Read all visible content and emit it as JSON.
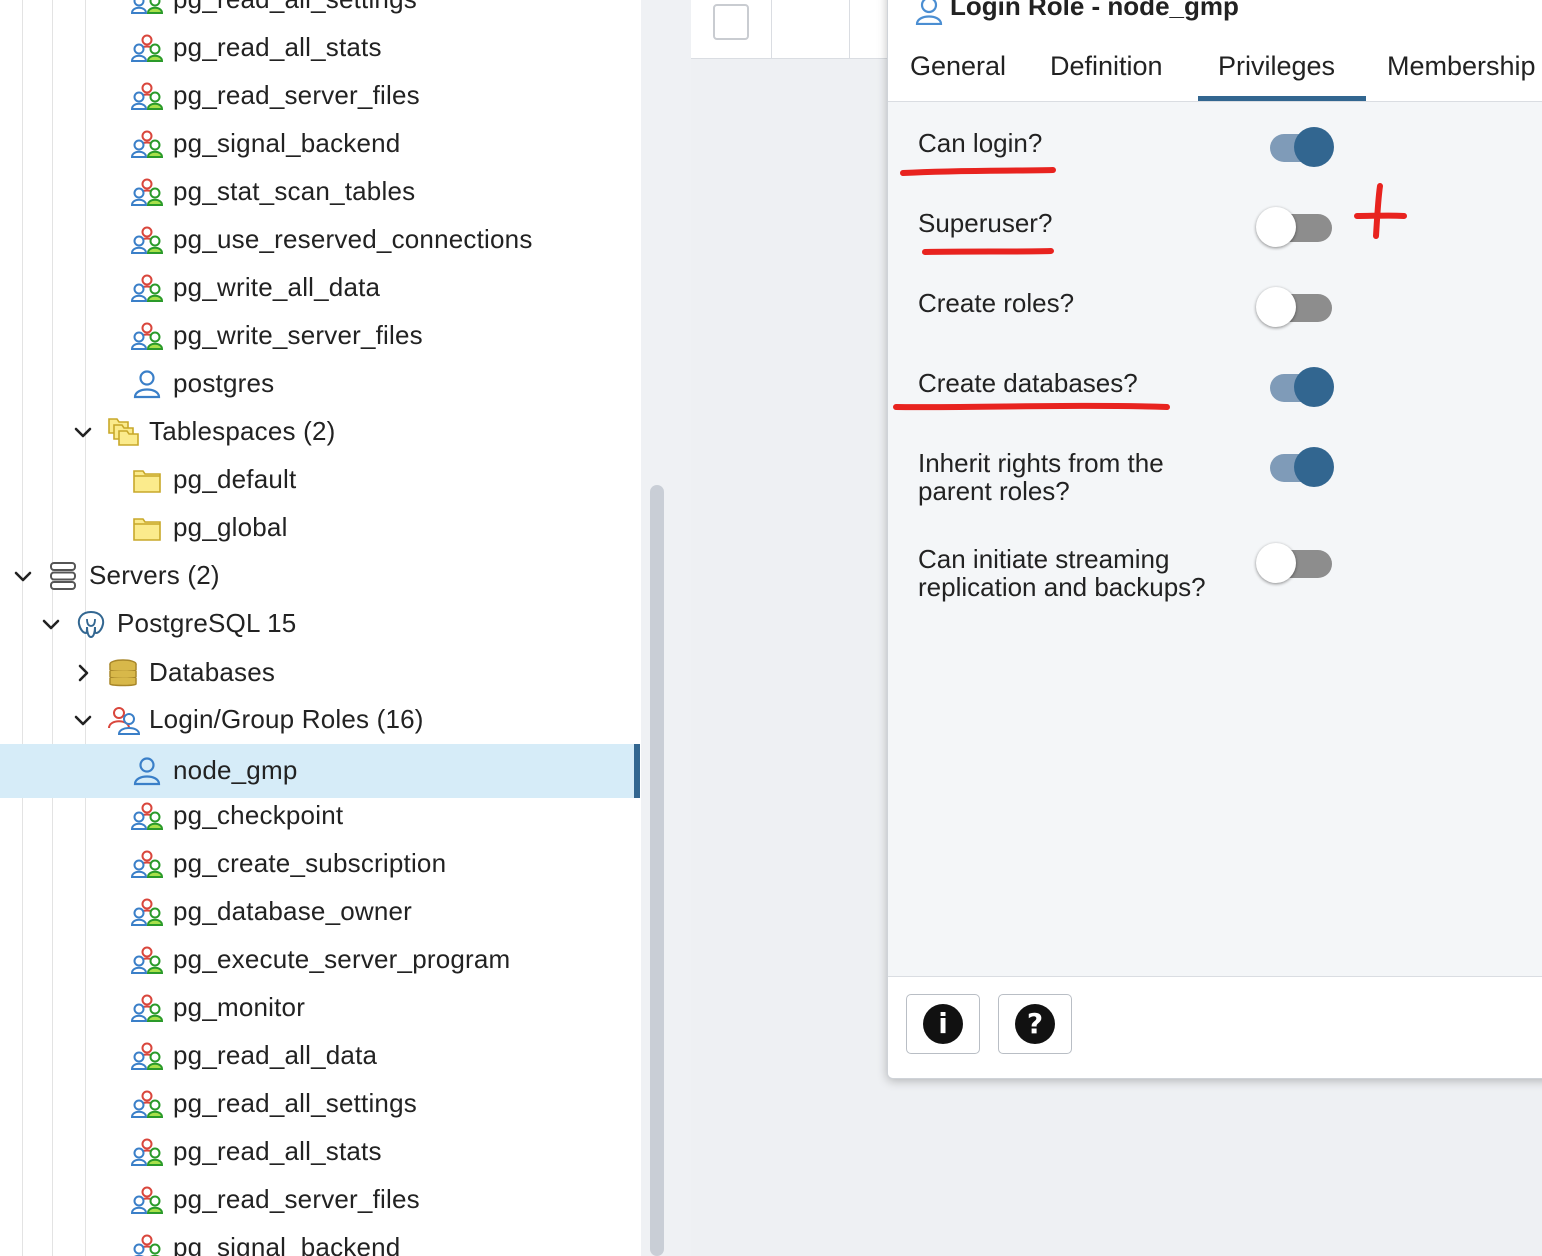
{
  "tree": {
    "items": [
      {
        "label": "pg_read_all_settings",
        "icon": "group-role-icon",
        "level": 3
      },
      {
        "label": "pg_read_all_stats",
        "icon": "group-role-icon",
        "level": 3
      },
      {
        "label": "pg_read_server_files",
        "icon": "group-role-icon",
        "level": 3
      },
      {
        "label": "pg_signal_backend",
        "icon": "group-role-icon",
        "level": 3
      },
      {
        "label": "pg_stat_scan_tables",
        "icon": "group-role-icon",
        "level": 3
      },
      {
        "label": "pg_use_reserved_connections",
        "icon": "group-role-icon",
        "level": 3
      },
      {
        "label": "pg_write_all_data",
        "icon": "group-role-icon",
        "level": 3
      },
      {
        "label": "pg_write_server_files",
        "icon": "group-role-icon",
        "level": 3
      },
      {
        "label": "postgres",
        "icon": "login-role-icon",
        "level": 3
      },
      {
        "label": "Tablespaces (2)",
        "icon": "tablespaces-icon",
        "level": 2,
        "chevron": "down"
      },
      {
        "label": "pg_default",
        "icon": "tablespace-icon",
        "level": 3
      },
      {
        "label": "pg_global",
        "icon": "tablespace-icon",
        "level": 3
      },
      {
        "label": "Servers (2)",
        "icon": "servers-icon",
        "level": 0,
        "chevron": "down"
      },
      {
        "label": "PostgreSQL 15",
        "icon": "postgresql-icon",
        "level": 1,
        "chevron": "down"
      },
      {
        "label": "Databases",
        "icon": "databases-icon",
        "level": 2,
        "chevron": "right"
      },
      {
        "label": "Login/Group Roles (16)",
        "icon": "roles-icon",
        "level": 2,
        "chevron": "down"
      },
      {
        "label": "node_gmp",
        "icon": "login-role-icon",
        "level": 3,
        "selected": true
      },
      {
        "label": "pg_checkpoint",
        "icon": "group-role-icon",
        "level": 3
      },
      {
        "label": "pg_create_subscription",
        "icon": "group-role-icon",
        "level": 3
      },
      {
        "label": "pg_database_owner",
        "icon": "group-role-icon",
        "level": 3
      },
      {
        "label": "pg_execute_server_program",
        "icon": "group-role-icon",
        "level": 3
      },
      {
        "label": "pg_monitor",
        "icon": "group-role-icon",
        "level": 3
      },
      {
        "label": "pg_read_all_data",
        "icon": "group-role-icon",
        "level": 3
      },
      {
        "label": "pg_read_all_settings",
        "icon": "group-role-icon",
        "level": 3
      },
      {
        "label": "pg_read_all_stats",
        "icon": "group-role-icon",
        "level": 3
      },
      {
        "label": "pg_read_server_files",
        "icon": "group-role-icon",
        "level": 3
      },
      {
        "label": "pg_signal_backend",
        "icon": "group-role-icon",
        "level": 3
      }
    ]
  },
  "dialog": {
    "title": "Login Role - node_gmp",
    "tabs": [
      {
        "label": "General",
        "active": false
      },
      {
        "label": "Definition",
        "active": false
      },
      {
        "label": "Privileges",
        "active": true
      },
      {
        "label": "Membership",
        "active": false
      }
    ],
    "privileges": [
      {
        "label": "Can login?",
        "on": true
      },
      {
        "label": "Superuser?",
        "on": false
      },
      {
        "label": "Create roles?",
        "on": false
      },
      {
        "label": "Create databases?",
        "on": true
      },
      {
        "label": "Inherit rights from the parent roles?",
        "on": true
      },
      {
        "label": "Can initiate streaming replication and backups?",
        "on": false
      }
    ],
    "footer": {
      "info_icon": "info-icon",
      "help_icon": "help-icon",
      "info_glyph": "i",
      "help_glyph": "?"
    }
  },
  "colors": {
    "accent": "#326690",
    "switch_on_track": "#7f9bb8",
    "switch_off_track": "#8d8d8d",
    "selected_row": "#d6ecf8",
    "annotation_red": "#e8231f"
  }
}
